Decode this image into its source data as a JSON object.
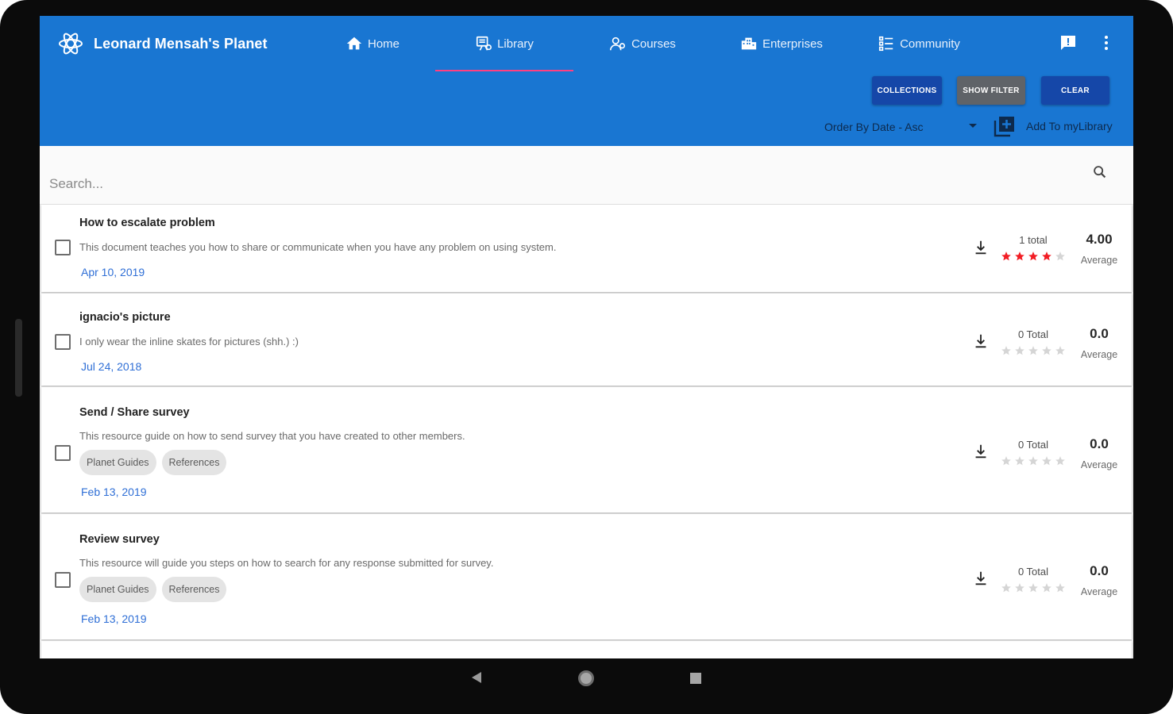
{
  "app": {
    "brand_title": "Leonard Mensah's Planet",
    "nav": [
      {
        "label": "Home",
        "icon": "home-icon"
      },
      {
        "label": "Library",
        "icon": "library-icon",
        "active": true
      },
      {
        "label": "Courses",
        "icon": "courses-icon"
      },
      {
        "label": "Enterprises",
        "icon": "enterprises-icon"
      },
      {
        "label": "Community",
        "icon": "community-icon"
      }
    ],
    "accent_color": "#1976d2",
    "active_tab_indicator_color": "#ff4081"
  },
  "toolbar": {
    "collections_label": "COLLECTIONS",
    "show_filter_label": "SHOW FILTER",
    "clear_label": "CLEAR",
    "order_label": "Order By Date - Asc",
    "add_label": "Add To myLibrary"
  },
  "search": {
    "placeholder": "Search..."
  },
  "resources": [
    {
      "title": "How to escalate problem",
      "description": "This document teaches you how to share or communicate when you have any problem on using system.",
      "date": "Apr 10, 2019",
      "tags": [],
      "total": "1 total",
      "stars_filled": 4,
      "average": "4.00",
      "average_label": "Average"
    },
    {
      "title": "ignacio's picture",
      "description": "I only wear the inline skates for pictures (shh.) :)",
      "date": "Jul 24, 2018",
      "tags": [],
      "total": "0 Total",
      "stars_filled": 0,
      "average": "0.0",
      "average_label": "Average"
    },
    {
      "title": "Send / Share survey",
      "description": "This resource guide on how to send survey that you have created to other members.",
      "date": "Feb 13, 2019",
      "tags": [
        "Planet Guides",
        "References"
      ],
      "total": "0 Total",
      "stars_filled": 0,
      "average": "0.0",
      "average_label": "Average"
    },
    {
      "title": "Review survey",
      "description": "This resource will guide you steps on how to search for any response submitted for survey.",
      "date": "Feb 13, 2019",
      "tags": [
        "Planet Guides",
        "References"
      ],
      "total": "0 Total",
      "stars_filled": 0,
      "average": "0.0",
      "average_label": "Average"
    }
  ],
  "colors": {
    "star_filled": "#f21d24",
    "star_empty": "#d5d5d5",
    "date_link": "#2f6fd6"
  }
}
